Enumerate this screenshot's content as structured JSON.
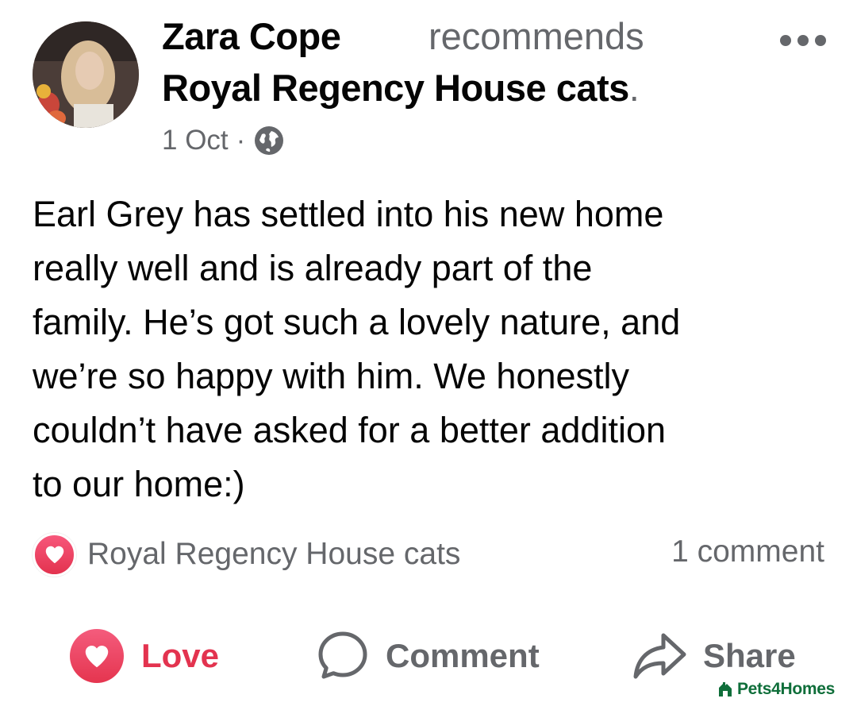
{
  "post": {
    "author": "Zara Cope",
    "action": "recommends",
    "page": "Royal Regency House cats",
    "page_suffix": ".",
    "date": "1 Oct",
    "separator": "·",
    "audience_icon": "globe-icon",
    "text": "Earl Grey has settled into his new home\nreally well and is already part of the\nfamily. He’s got such a lovely nature, and\nwe’re so happy with him. We honestly\ncouldn’t have asked for a better addition\nto our home:)"
  },
  "reactions": {
    "icon": "heart-icon",
    "by": "Royal Regency House cats",
    "comment_count": "1 comment"
  },
  "actions": {
    "love_label": "Love",
    "comment_label": "Comment",
    "share_label": "Share"
  },
  "watermark": {
    "text": "Pets4Homes"
  },
  "colors": {
    "love": "#e3334f",
    "secondary_text": "#65676b",
    "primary_text": "#050505",
    "watermark": "#0f6e3a"
  }
}
